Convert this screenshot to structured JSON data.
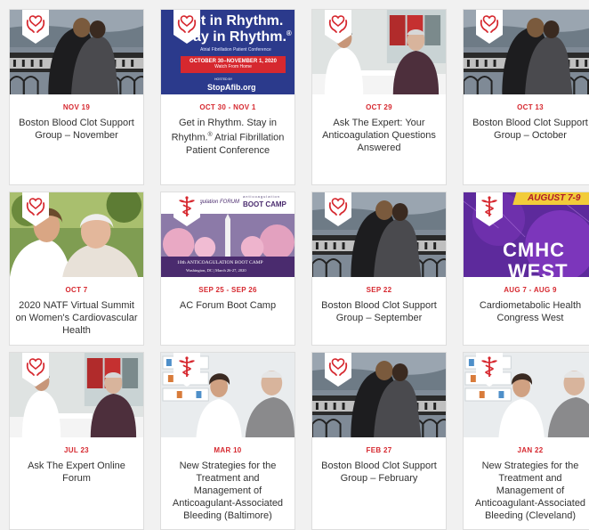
{
  "accent_color": "#d6282f",
  "badge_icons": {
    "heart_hands": "heart-hands-icon",
    "caduceus": "caduceus-icon"
  },
  "events": [
    {
      "date": "NOV 19",
      "title": "Boston Blood Clot Support Group – November"
    },
    {
      "date": "OCT 30 - NOV 1",
      "title": "Get in Rhythm. Stay in Rhythm.® Atrial Fibrillation Patient Conference"
    },
    {
      "date": "OCT 29",
      "title": "Ask The Expert: Your Anticoagulation Questions Answered"
    },
    {
      "date": "OCT 13",
      "title": "Boston Blood Clot Support Group – October"
    },
    {
      "date": "OCT 7",
      "title": "2020 NATF Virtual Summit on Women's Cardiovascular Health"
    },
    {
      "date": "SEP 25 - SEP 26",
      "title": "AC Forum Boot Camp"
    },
    {
      "date": "SEP 22",
      "title": "Boston Blood Clot Support Group – September"
    },
    {
      "date": "AUG 7 - AUG 9",
      "title": "Cardiometabolic Health Congress West"
    },
    {
      "date": "JUL 23",
      "title": "Ask The Expert Online Forum"
    },
    {
      "date": "MAR 10",
      "title": "New Strategies for the Treatment and Management of Anticoagulant-Associated Bleeding (Baltimore)"
    },
    {
      "date": "FEB 27",
      "title": "Boston Blood Clot Support Group – February"
    },
    {
      "date": "JAN 22",
      "title": "New Strategies for the Treatment and Management of Anticoagulant-Associated Bleeding (Cleveland)"
    }
  ],
  "promos": {
    "rhythm": {
      "headline1": "et in Rhythm.",
      "headline2": "ay in Rhythm.",
      "reg": "®",
      "subtitle": "Atrial Fibrillation Patient Conference",
      "dates": "OCTOBER 30–NOVEMBER 1, 2020",
      "watch": "Watch From Home",
      "hosted": "HOSTED BY",
      "brand": "StopAfib.org"
    },
    "bootcamp": {
      "top_small": "anticoagulation",
      "left": "agulation FORUM",
      "right": "BOOT CAMP",
      "line1": "10th ANTICOAGULATION BOOT CAMP",
      "line2": "Washington, DC | March 26-27, 2020"
    },
    "cmhc": {
      "banner": "AUGUST 7-9",
      "big1": "CMHC",
      "big2": "WEST"
    }
  }
}
